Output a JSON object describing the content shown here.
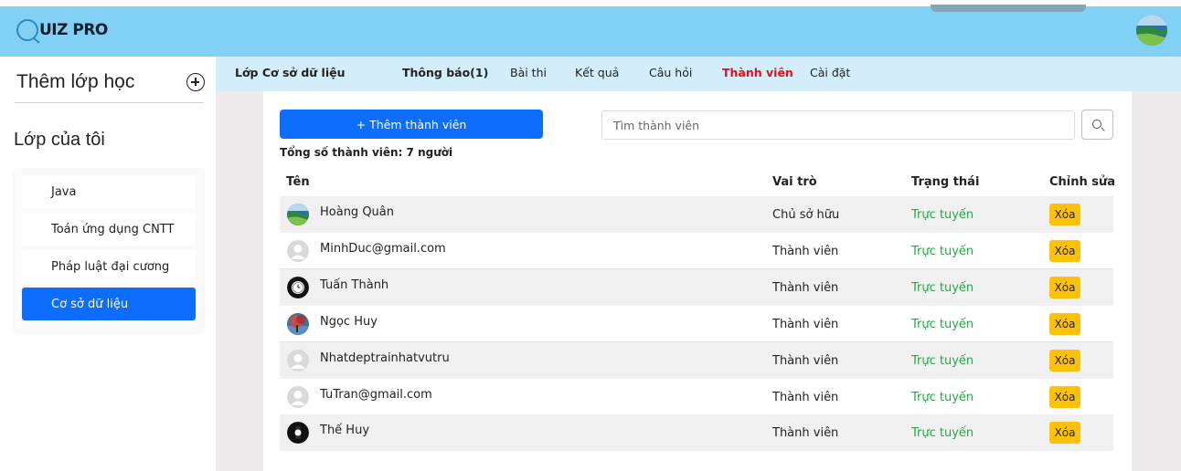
{
  "app": {
    "logo_text": "UIZ PRO",
    "brand_color": "#83d0f5"
  },
  "sidebar": {
    "add_class_label": "Thêm lớp học",
    "my_classes_title": "Lớp của tôi",
    "classes": [
      {
        "label": "Java",
        "active": false
      },
      {
        "label": "Toán ứng dụng CNTT",
        "active": false
      },
      {
        "label": "Pháp luật đại cương",
        "active": false
      },
      {
        "label": "Cơ sở dữ liệu",
        "active": true
      }
    ]
  },
  "tabs": {
    "class_name": "Lớp Cơ sở dữ liệu",
    "items": [
      {
        "label": "Thông báo(1)"
      },
      {
        "label": "Bài thi"
      },
      {
        "label": "Kết quả"
      },
      {
        "label": "Câu hỏi"
      },
      {
        "label": "Thành viên",
        "active": true
      },
      {
        "label": "Cài đặt"
      }
    ]
  },
  "members": {
    "add_button_label": "+ Thêm thành viên",
    "search_placeholder": "Tìm thành viên",
    "total_label": "Tổng số thành viên: 7 người",
    "columns": {
      "name": "Tên",
      "role": "Vai trò",
      "status": "Trạng thái",
      "edit": "Chỉnh sửa"
    },
    "delete_label": "Xóa",
    "rows": [
      {
        "name": "Hoàng Quân",
        "role": "Chủ sở hữu",
        "status": "Trực tuyến",
        "avatar": "landscape-avatar"
      },
      {
        "name": "MinhDuc@gmail.com",
        "role": "Thành viên",
        "status": "Trực tuyến",
        "avatar": "default-avatar"
      },
      {
        "name": "Tuấn Thành",
        "role": "Thành viên",
        "status": "Trực tuyến",
        "avatar": "watch-avatar"
      },
      {
        "name": "Ngọc Huy",
        "role": "Thành viên",
        "status": "Trực tuyến",
        "avatar": "tree-avatar"
      },
      {
        "name": "Nhatdeptrainhatvutru",
        "role": "Thành viên",
        "status": "Trực tuyến",
        "avatar": "default-avatar"
      },
      {
        "name": "TuTran@gmail.com",
        "role": "Thành viên",
        "status": "Trực tuyến",
        "avatar": "default-avatar"
      },
      {
        "name": "Thế Huy",
        "role": "Thành viên",
        "status": "Trực tuyến",
        "avatar": "dark-avatar"
      }
    ]
  },
  "colors": {
    "primary": "#0d6efd",
    "active_tab": "#e0101b",
    "online": "#28a745",
    "delete": "#ffc107"
  }
}
